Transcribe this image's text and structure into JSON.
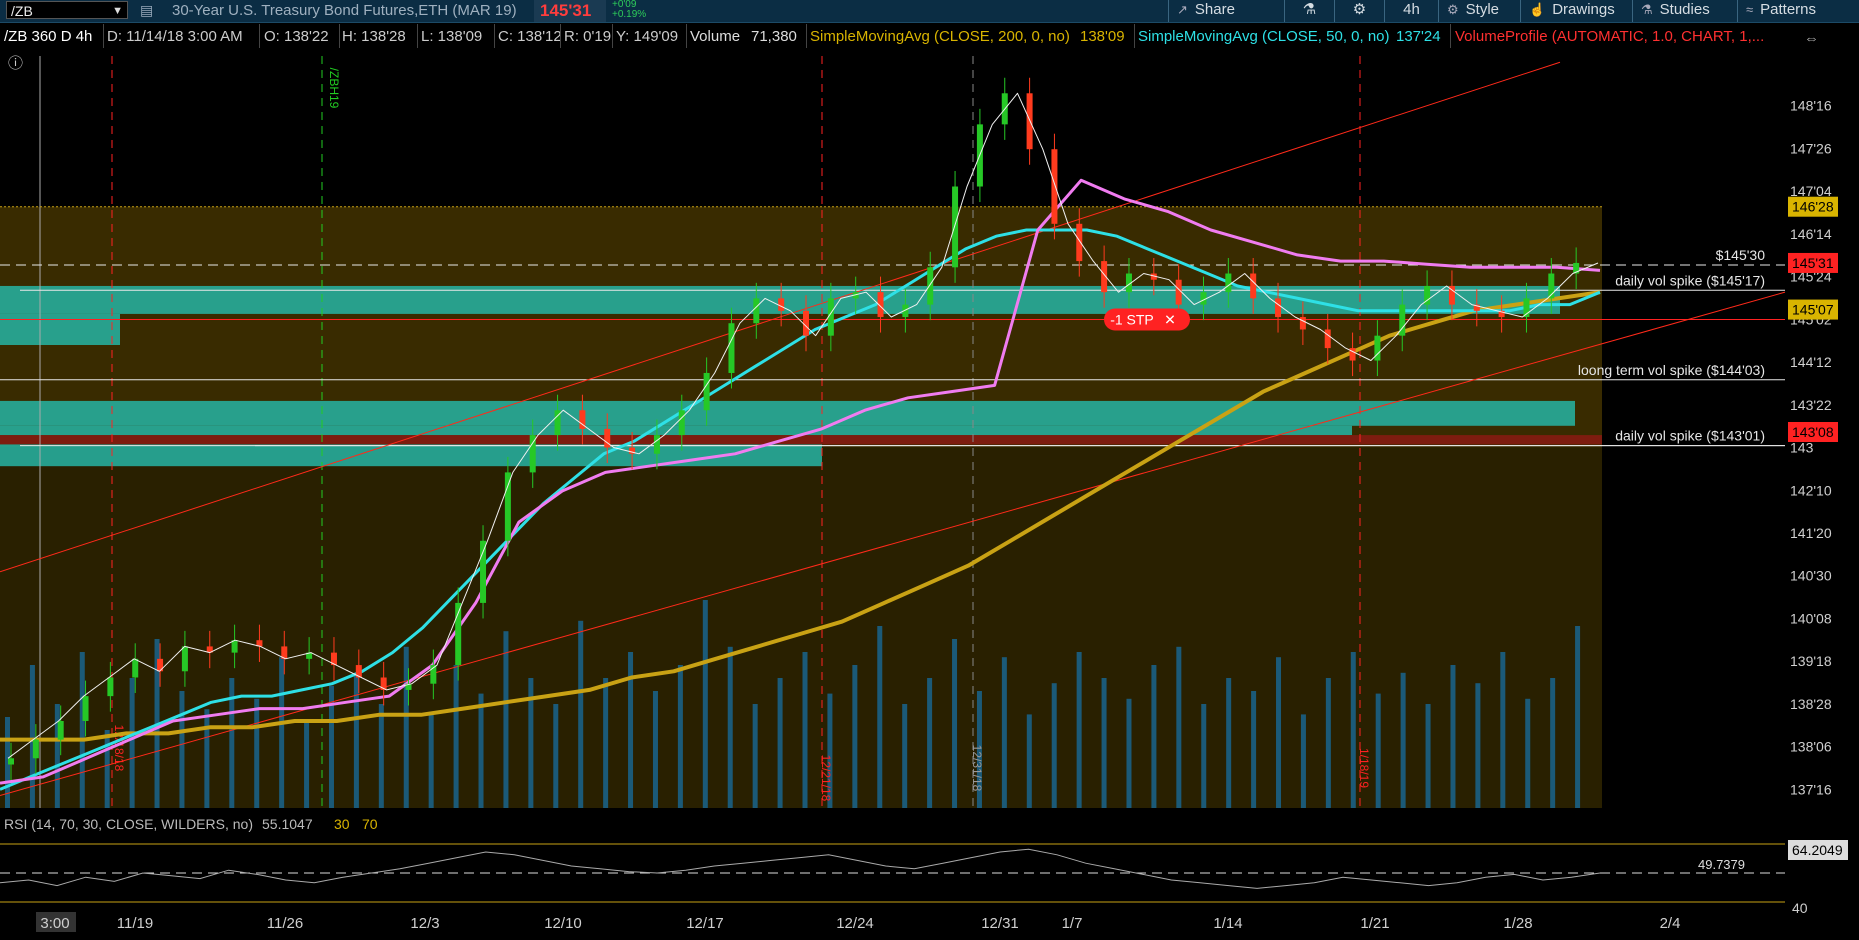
{
  "topbar": {
    "symbol": "/ZB",
    "description": "30-Year U.S. Treasury Bond Futures,ETH (MAR 19)",
    "last": "145'31",
    "change": "+0'09",
    "change_pct": "+0.19%",
    "buttons": [
      {
        "label": "Share",
        "icon": "share-icon"
      },
      {
        "label": "",
        "icon": "flask-icon"
      },
      {
        "label": "",
        "icon": "gear-icon"
      },
      {
        "label": "4h",
        "icon": "timeframe"
      },
      {
        "label": "Style",
        "icon": "style-icon"
      },
      {
        "label": "Drawings",
        "icon": "drawings-icon"
      },
      {
        "label": "Studies",
        "icon": "studies-icon"
      },
      {
        "label": "Patterns",
        "icon": "patterns-icon"
      }
    ]
  },
  "studybar": {
    "period": "/ZB 360 D 4h",
    "date": "D: 11/14/18 3:00 AM",
    "open": "O: 138'22",
    "high": "H: 138'28",
    "low": "L: 138'09",
    "close": "C: 138'12",
    "range": "R: 0'19",
    "y": "Y: 149'09",
    "volume_label": "Volume",
    "volume_value": "71,380",
    "sma200_label": "SimpleMovingAvg (CLOSE, 200, 0, no)",
    "sma200_value": "138'09",
    "sma50_label": "SimpleMovingAvg (CLOSE, 50, 0, no)",
    "sma50_value": "137'24",
    "vp_label": "VolumeProfile (AUTOMATIC, 1.0, CHART, 1,..."
  },
  "colors": {
    "background": "#000000",
    "sma50": "#2ee0e6",
    "sma200": "#c9a214",
    "sma_pink": "#f07cf0",
    "candle_up": "#26c826",
    "candle_down": "#ff3b1e",
    "volume": "#1b5a78",
    "profile_cyan": "#26b5a5",
    "profile_red": "#8a1a12",
    "value_area": "#4a3a00",
    "trendline": "#ff2a1a",
    "marker_red": "#ff2222",
    "marker_yellow": "#d9b400"
  },
  "chart_data": {
    "type": "candlestick",
    "y_ticks": [
      "148'16",
      "147'26",
      "147'04",
      "146'14",
      "145'24",
      "145'02",
      "144'12",
      "143'22",
      "143",
      "142'10",
      "141'20",
      "140'30",
      "140'08",
      "139'18",
      "138'28",
      "138'06",
      "137'16"
    ],
    "y_tick_values": [
      148.5,
      147.8125,
      147.125,
      146.4375,
      145.75,
      145.0625,
      144.375,
      143.6875,
      143.0,
      142.3125,
      141.625,
      140.9375,
      140.25,
      139.5625,
      138.875,
      138.1875,
      137.5
    ],
    "ylim": [
      137.2,
      149.3
    ],
    "x_ticks": [
      "3:00",
      "11/19",
      "11/26",
      "12/3",
      "12/10",
      "12/17",
      "12/24",
      "12/31",
      "1/7",
      "1/14",
      "1/21",
      "1/28",
      "2/4"
    ],
    "vertical_labels": [
      "/ZBH19",
      "12/18/18",
      "12/21/18",
      "12/31/18",
      "1/18/19"
    ],
    "price_markers": [
      {
        "label": "146'28",
        "value": 146.875,
        "color": "yellow"
      },
      {
        "label": "145'31",
        "value": 145.97,
        "color": "red"
      },
      {
        "label": "145'07",
        "value": 145.22,
        "color": "yellow"
      },
      {
        "label": "143'08",
        "value": 143.25,
        "color": "red"
      }
    ],
    "horizontal_levels": [
      {
        "label": "$145'30",
        "value": 145.9375,
        "style": "dashed"
      },
      {
        "label": "daily vol spike ($145'17)",
        "value": 145.53,
        "style": "solid"
      },
      {
        "label": "",
        "value": 145.06,
        "style": "red"
      },
      {
        "label": "loong term vol spike ($144'03)",
        "value": 144.09,
        "style": "solid"
      },
      {
        "label": "daily vol spike ($143'01)",
        "value": 143.03,
        "style": "solid"
      }
    ],
    "order": {
      "label": "-1 STP",
      "value": 145.06
    },
    "series": [
      {
        "name": "Price (close)",
        "values": [
          138.0,
          138.3,
          138.6,
          139.0,
          139.3,
          139.6,
          139.4,
          139.8,
          139.7,
          139.9,
          139.8,
          139.6,
          139.7,
          139.5,
          139.3,
          139.1,
          139.2,
          139.5,
          140.5,
          141.5,
          142.6,
          143.2,
          143.6,
          143.3,
          143.0,
          142.9,
          143.2,
          143.6,
          144.2,
          145.0,
          145.4,
          145.2,
          144.8,
          145.4,
          145.5,
          145.1,
          145.3,
          145.9,
          147.2,
          148.2,
          148.7,
          147.8,
          146.6,
          146.0,
          145.5,
          145.8,
          145.7,
          145.3,
          145.5,
          145.8,
          145.4,
          145.1,
          144.9,
          144.6,
          144.4,
          144.8,
          145.3,
          145.6,
          145.3,
          145.2,
          145.1,
          145.4,
          145.8,
          145.97
        ]
      },
      {
        "name": "SMA 50",
        "values": [
          137.5,
          137.7,
          137.9,
          138.1,
          138.3,
          138.5,
          138.7,
          138.9,
          139.0,
          139.0,
          139.1,
          139.2,
          139.4,
          139.7,
          140.1,
          140.6,
          141.1,
          141.6,
          142.1,
          142.5,
          142.9,
          143.1,
          143.4,
          143.7,
          144.0,
          144.3,
          144.6,
          144.9,
          145.1,
          145.3,
          145.6,
          145.9,
          146.2,
          146.4,
          146.5,
          146.5,
          146.5,
          146.4,
          146.2,
          146.0,
          145.8,
          145.6,
          145.5,
          145.4,
          145.3,
          145.2,
          145.2,
          145.2,
          145.2,
          145.2,
          145.2,
          145.3,
          145.3,
          145.5
        ]
      },
      {
        "name": "SMA 200",
        "values": [
          138.3,
          138.3,
          138.3,
          138.4,
          138.4,
          138.5,
          138.5,
          138.6,
          138.6,
          138.7,
          138.7,
          138.8,
          138.9,
          139.0,
          139.1,
          139.3,
          139.4,
          139.6,
          139.8,
          140.0,
          140.2,
          140.5,
          140.8,
          141.1,
          141.5,
          141.9,
          142.3,
          142.7,
          143.1,
          143.5,
          143.9,
          144.2,
          144.5,
          144.8,
          145.0,
          145.2,
          145.3,
          145.4,
          145.5
        ]
      },
      {
        "name": "Pink MA",
        "values": [
          137.6,
          137.7,
          138.0,
          138.3,
          138.6,
          138.7,
          138.8,
          138.8,
          138.9,
          139.0,
          139.5,
          140.5,
          141.8,
          142.3,
          142.6,
          142.7,
          142.8,
          142.9,
          143.1,
          143.3,
          143.6,
          143.8,
          143.9,
          144.0,
          146.5,
          147.3,
          147.0,
          146.8,
          146.5,
          146.3,
          146.1,
          146.0,
          146.0,
          145.95,
          145.9,
          145.9,
          145.9,
          145.85
        ]
      }
    ],
    "volume": [
      0.35,
      0.55,
      0.4,
      0.6,
      0.3,
      0.5,
      0.65,
      0.45,
      0.38,
      0.5,
      0.42,
      0.58,
      0.33,
      0.47,
      0.52,
      0.4,
      0.62,
      0.36,
      0.55,
      0.44,
      0.68,
      0.5,
      0.4,
      0.72,
      0.5,
      0.6,
      0.45,
      0.55,
      0.8,
      0.62,
      0.4,
      0.5,
      0.6,
      0.44,
      0.55,
      0.7,
      0.4,
      0.5,
      0.65,
      0.45,
      0.58,
      0.36,
      0.48,
      0.6,
      0.5,
      0.42,
      0.55,
      0.62,
      0.4,
      0.5,
      0.45,
      0.58,
      0.36,
      0.5,
      0.6,
      0.44,
      0.52,
      0.4,
      0.55,
      0.48,
      0.6,
      0.42,
      0.5,
      0.7
    ],
    "rsi": {
      "label": "RSI (14, 70, 30, CLOSE, WILDERS, no)",
      "value": "55.1047",
      "overbought": "70",
      "oversold": "30",
      "right_labels": [
        "64.2049",
        "40"
      ],
      "mid_label": "49.7379",
      "values": [
        48,
        50,
        46,
        52,
        49,
        55,
        53,
        51,
        57,
        54,
        50,
        48,
        52,
        55,
        58,
        62,
        66,
        70,
        68,
        64,
        60,
        58,
        56,
        55,
        57,
        60,
        62,
        64,
        66,
        68,
        64,
        60,
        58,
        62,
        66,
        70,
        72,
        68,
        62,
        58,
        54,
        50,
        48,
        46,
        44,
        46,
        48,
        52,
        50,
        48,
        46,
        48,
        52,
        54,
        50,
        52,
        55
      ]
    }
  }
}
